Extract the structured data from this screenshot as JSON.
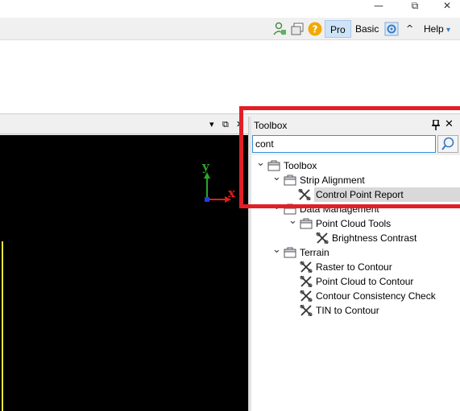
{
  "window": {
    "minimize_glyph": "—",
    "restore_glyph": "⧉",
    "close_glyph": "✕"
  },
  "toolbar": {
    "icons": [
      "user-license-icon",
      "copy-windows-icon",
      "help-question-icon",
      "settings-gear-icon",
      "collapse-ribbon-icon"
    ],
    "pro_label": "Pro",
    "basic_label": "Basic",
    "help_label": "Help",
    "help_dropdown_glyph": "▾",
    "collapse_glyph": "^"
  },
  "view": {
    "menu_glyph": "▾",
    "float_glyph": "⧉",
    "close_glyph": "✕",
    "axis_y": "y",
    "axis_x": "x"
  },
  "toolbox": {
    "title": "Toolbox",
    "pin_glyph": "📌",
    "close_glyph": "✕",
    "search_value": "cont",
    "tree": [
      {
        "label": "Toolbox",
        "type": "folder",
        "expanded": true,
        "level": 0
      },
      {
        "label": "Strip Alignment",
        "type": "folder",
        "expanded": true,
        "level": 1
      },
      {
        "label": "Control Point Report",
        "type": "tool",
        "level": 2,
        "selected": true
      },
      {
        "label": "Data Management",
        "type": "folder",
        "expanded": true,
        "level": 1
      },
      {
        "label": "Point Cloud Tools",
        "type": "folder",
        "expanded": true,
        "level": 2
      },
      {
        "label": "Brightness Contrast",
        "type": "tool",
        "level": 3
      },
      {
        "label": "Terrain",
        "type": "folder",
        "expanded": true,
        "level": 1
      },
      {
        "label": "Raster to Contour",
        "type": "tool",
        "level": 2
      },
      {
        "label": "Point Cloud to Contour",
        "type": "tool",
        "level": 2
      },
      {
        "label": "Contour Consistency Check",
        "type": "tool",
        "level": 2
      },
      {
        "label": "TIN to Contour",
        "type": "tool",
        "level": 2
      }
    ]
  },
  "colors": {
    "highlight_red": "#e21f26",
    "active_mode": "#cfe3f7",
    "axis_y": "#2aa52a",
    "axis_x": "#e01c1c"
  }
}
